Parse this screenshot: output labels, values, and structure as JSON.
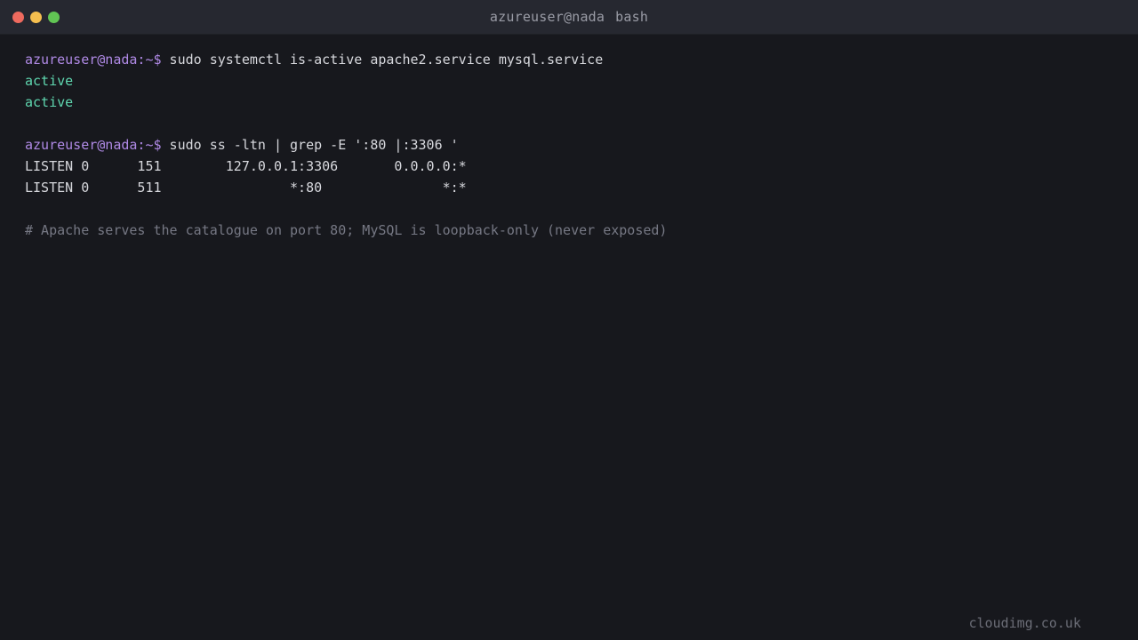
{
  "window": {
    "title_user_host": "azureuser@nada",
    "title_shell": "bash",
    "colors": {
      "background": "#17181d",
      "titlebar": "#262830",
      "prompt": "#b08ae6",
      "status_ok": "#5fd7b0",
      "comment": "#767884",
      "close": "#ee6a5e",
      "minimize": "#f5bf4f",
      "maximize": "#61c554"
    }
  },
  "terminal": {
    "prompt": "azureuser@nada:~$",
    "cmd1": " sudo systemctl is-active apache2.service mysql.service",
    "out1a": "active",
    "out1b": "active",
    "cmd2": " sudo ss -ltn | grep -E ':80 |:3306 '",
    "row1": "LISTEN 0      151        127.0.0.1:3306       0.0.0.0:*",
    "row2": "LISTEN 0      511                *:80               *:*",
    "comment": "# Apache serves the catalogue on port 80; MySQL is loopback-only (never exposed)"
  },
  "watermark": "cloudimg.co.uk"
}
